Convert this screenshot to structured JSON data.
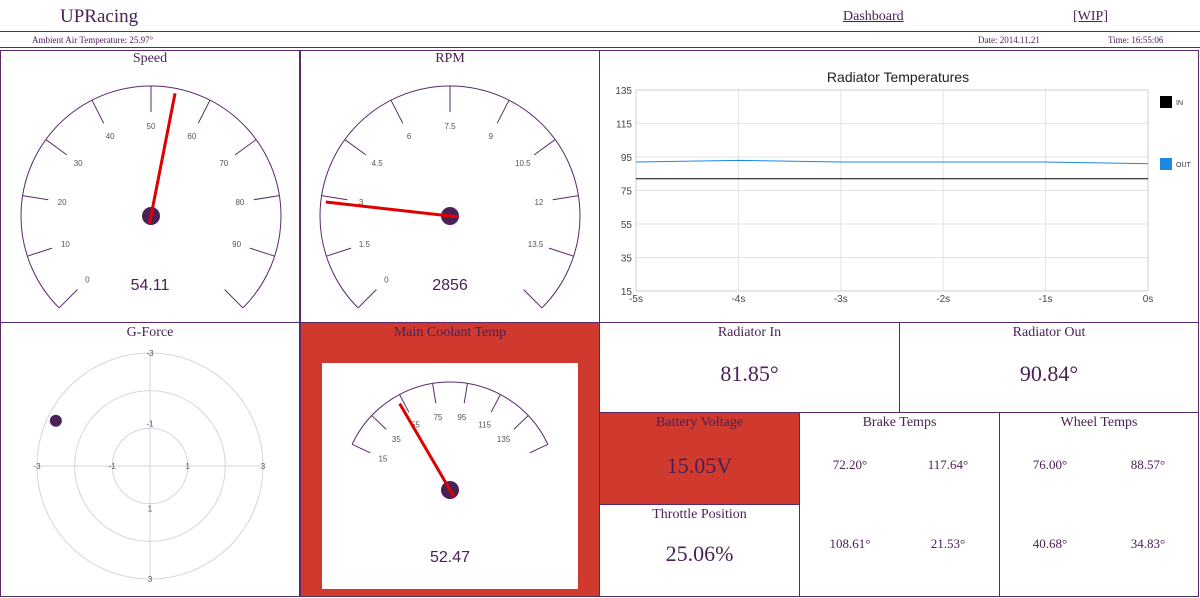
{
  "header": {
    "brand": "UPRacing",
    "nav": {
      "dashboard": "Dashboard",
      "wip": "[WIP]"
    },
    "ambient": "Ambient Air Temperature: 25.97°",
    "date": "Date: 2014.11.21",
    "time": "Time: 16:55:06"
  },
  "speed": {
    "title": "Speed",
    "value": "54.11",
    "ticks": [
      "0",
      "10",
      "20",
      "30",
      "40",
      "50",
      "60",
      "70",
      "80",
      "90"
    ],
    "min": 0,
    "max": 100,
    "reading": 54.11
  },
  "rpm": {
    "title": "RPM",
    "value": "2856",
    "ticks": [
      "0",
      "1.5",
      "3",
      "4.5",
      "6",
      "7.5",
      "9",
      "10.5",
      "12",
      "13.5"
    ],
    "min": 0,
    "max": 15,
    "reading": 2.856
  },
  "gforce": {
    "title": "G-Force",
    "axis_labels": {
      "top_outer": "-3",
      "top_inner": "-1",
      "bottom_inner": "1",
      "bottom_outer": "3",
      "left_outer": "-3",
      "left_inner": "-1",
      "right_inner": "1",
      "right_outer": "3"
    },
    "point": {
      "x": -2.5,
      "y": -1.2
    }
  },
  "coolant": {
    "title": "Main Coolant Temp",
    "value": "52.47",
    "ticks": [
      "15",
      "35",
      "55",
      "75",
      "95",
      "115",
      "135"
    ],
    "min": 15,
    "max": 155,
    "reading": 52.47,
    "alert_color": "#d0392d"
  },
  "radiator_chart": {
    "title": "Radiator Temperatures"
  },
  "chart_data": {
    "type": "line",
    "title": "Radiator Temperatures",
    "xlabel": "",
    "ylabel": "",
    "x_ticks": [
      "-5s",
      "-4s",
      "-3s",
      "-2s",
      "-1s",
      "0s"
    ],
    "y_ticks": [
      "135",
      "115",
      "95",
      "75",
      "55",
      "35",
      "15"
    ],
    "xlim": [
      -5,
      0
    ],
    "ylim": [
      15,
      135
    ],
    "grid": true,
    "legend": "right",
    "series": [
      {
        "name": "IN",
        "color": "#000000",
        "x": [
          -5,
          -4,
          -3,
          -2,
          -1,
          0
        ],
        "values": [
          82,
          82,
          82,
          82,
          82,
          82
        ]
      },
      {
        "name": "OUT",
        "color": "#1e88e5",
        "x": [
          -5,
          -4,
          -3,
          -2,
          -1,
          0
        ],
        "values": [
          92,
          93,
          92,
          92,
          92,
          91
        ]
      }
    ]
  },
  "radiator_in": {
    "title": "Radiator In",
    "value": "81.85°"
  },
  "radiator_out": {
    "title": "Radiator Out",
    "value": "90.84°"
  },
  "battery": {
    "title": "Battery Voltage",
    "value": "15.05V",
    "alert_color": "#d0392d"
  },
  "throttle": {
    "title": "Throttle Position",
    "value": "25.06%"
  },
  "brake": {
    "title": "Brake Temps",
    "fl": "72.20°",
    "fr": "117.64°",
    "rl": "108.61°",
    "rr": "21.53°"
  },
  "wheel": {
    "title": "Wheel Temps",
    "fl": "76.00°",
    "fr": "88.57°",
    "rl": "40.68°",
    "rr": "34.83°"
  }
}
